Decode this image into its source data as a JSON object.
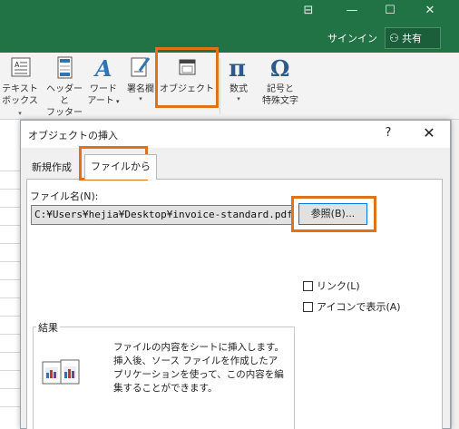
{
  "window": {
    "controls": {
      "ribbon_display": "⊟",
      "minimize": "—",
      "maximize": "☐",
      "close": "✕"
    },
    "signin_label": "サインイン",
    "share_label": "共有"
  },
  "ribbon": {
    "buttons": [
      {
        "label_line1": "テキスト",
        "label_line2": "ボックス",
        "icon": "text-box-icon",
        "has_caret": true
      },
      {
        "label_line1": "ヘッダーと",
        "label_line2": "フッター",
        "icon": "header-footer-icon",
        "has_caret": false
      },
      {
        "label_line1": "ワード",
        "label_line2": "アート",
        "icon": "wordart-icon",
        "has_caret": true
      },
      {
        "label_line1": "署名欄",
        "label_line2": "",
        "icon": "signature-line-icon",
        "has_caret": true
      },
      {
        "label_line1": "オブジェクト",
        "label_line2": "",
        "icon": "object-icon",
        "has_caret": false
      },
      {
        "label_line1": "数式",
        "label_line2": "",
        "icon": "equation-icon",
        "has_caret": true
      },
      {
        "label_line1": "記号と",
        "label_line2": "特殊文字",
        "icon": "symbol-icon",
        "has_caret": false
      }
    ]
  },
  "dialog": {
    "title": "オブジェクトの挿入",
    "help": "?",
    "close": "✕",
    "tabs": [
      {
        "label": "新規作成",
        "selected": false
      },
      {
        "label": "ファイルから",
        "selected": true
      }
    ],
    "filename_label": "ファイル名(N):",
    "filename_value": "C:¥Users¥hejia¥Desktop¥invoice-standard.pdf",
    "browse_label": "参照(B)...",
    "checkboxes": [
      {
        "label": "リンク(L)",
        "checked": false
      },
      {
        "label": "アイコンで表示(A)",
        "checked": false
      }
    ],
    "result_label": "結果",
    "result_text": "ファイルの内容をシートに挿入します。挿入後、ソース ファイルを作成したアプリケーションを使って、この内容を編集することができます。"
  },
  "colors": {
    "excel_green": "#217346",
    "highlight_orange": "#e0731a",
    "accent_blue": "#0078d7"
  }
}
